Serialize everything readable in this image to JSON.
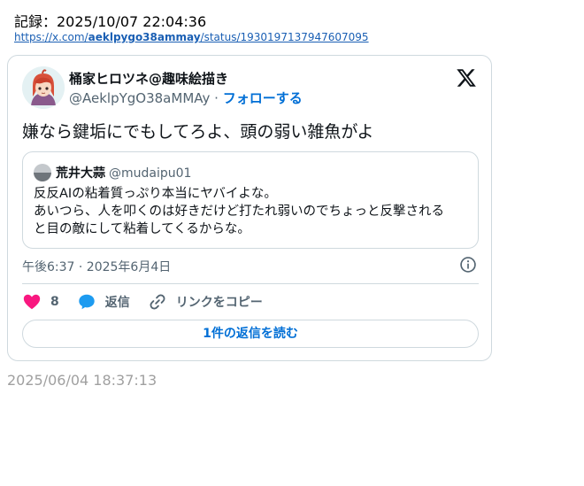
{
  "record": {
    "label": "記録：2025/10/07 22:04:36",
    "link_prefix": "https://x.com/",
    "link_user": "aeklpygo38ammay",
    "link_suffix": "/status/1930197137947607095"
  },
  "tweet": {
    "author_name": "桶家ヒロツネ@趣味絵描き",
    "author_handle": "@AeklpYgO38aMMAy",
    "separator": "·",
    "follow_label": "フォローする",
    "text": "嫌なら鍵垢にでもしてろよ、頭の弱い雑魚がよ",
    "timestamp": "午後6:37 · 2025年6月4日",
    "like_count": "8",
    "reply_label": "返信",
    "copy_link_label": "リンクをコピー",
    "read_replies_label": "1件の返信を読む"
  },
  "quote": {
    "author_name": "荒井大蒜",
    "author_handle": "@mudaipu01",
    "lines": [
      "反反AIの粘着質っぷり本当にヤバイよな。",
      "あいつら、人を叩くのは好きだけど打たれ弱いのでちょっと反撃される",
      "と目の敵にして粘着してくるからな。"
    ]
  },
  "footer": {
    "date": "2025/06/04 18:37:13"
  },
  "icons": {
    "x_logo": "x-logo-icon",
    "info": "info-icon",
    "like": "heart-icon",
    "reply": "speech-bubble-icon",
    "copy_link": "link-icon"
  },
  "colors": {
    "accent": "#006fd6",
    "like": "#f91880",
    "reply": "#1d9bf0",
    "muted": "#536471",
    "border": "#cfd9de"
  }
}
